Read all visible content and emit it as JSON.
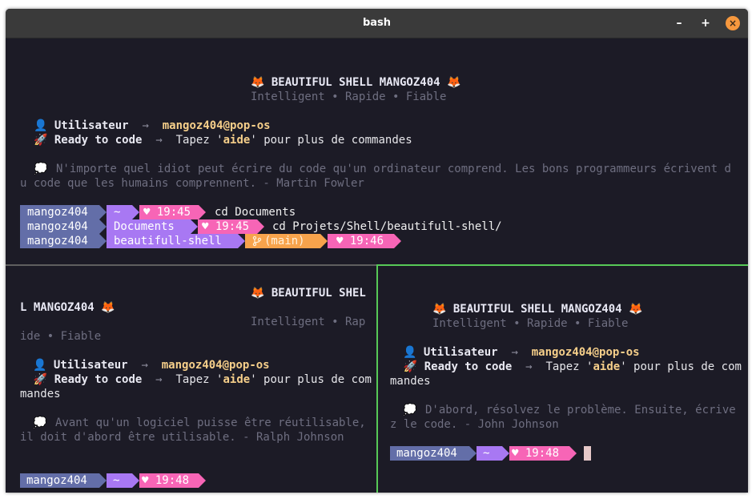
{
  "window": {
    "title": "bash",
    "minimize_glyph": "–",
    "maximize_glyph": "+",
    "close_glyph": "×"
  },
  "banner": {
    "title": "🦊 BEAUTIFUL SHELL MANGOZ404 🦊",
    "subtitle": "Intelligent • Rapide • Fiable",
    "user_icon": "👤",
    "user_label": "Utilisateur",
    "arrow": "→",
    "user_value": "mangoz404@pop-os",
    "rocket_icon": "🚀",
    "ready_label": "Ready to code",
    "ready_pre": "Tapez '",
    "ready_cmd": "aide",
    "ready_post": "' pour plus de commandes",
    "quote_icon": "💭"
  },
  "panes": {
    "top": {
      "quote": "N'importe quel idiot peut écrire du code qu'un ordinateur comprend. Les bons programmeurs écrivent du code que les humains comprennent. - Martin Fowler",
      "prompts": [
        {
          "user": "mangoz404",
          "dir": "~",
          "time": "♥ 19:45",
          "command": "cd Documents"
        },
        {
          "user": "mangoz404",
          "dir": "Documents",
          "time": "♥ 19:45",
          "command": "cd Projets/Shell/beautifull-shell/"
        },
        {
          "user": "mangoz404",
          "dir": "beautifull-shell",
          "git": "(main)",
          "git_icon": "branch-icon",
          "time": "♥ 19:46",
          "command": ""
        }
      ]
    },
    "bottom_left": {
      "quote": "Avant qu'un logiciel puisse être réutilisable, il doit d'abord être utilisable. - Ralph Johnson",
      "prompts": [
        {
          "user": "mangoz404",
          "dir": "~",
          "time": "♥ 19:48",
          "command": ""
        }
      ]
    },
    "bottom_right": {
      "quote": "D'abord, résolvez le problème. Ensuite, écrivez le code. - John Johnson",
      "prompts": [
        {
          "user": "mangoz404",
          "dir": "~",
          "time": "♥ 19:48",
          "command": ""
        }
      ]
    }
  },
  "colors": {
    "terminal_bg": "#1c1b26",
    "segment_user": "#636ea8",
    "segment_dir": "#a878f3",
    "segment_git": "#f7a34c",
    "segment_time": "#f765b6",
    "active_pane_border": "#57c957"
  }
}
